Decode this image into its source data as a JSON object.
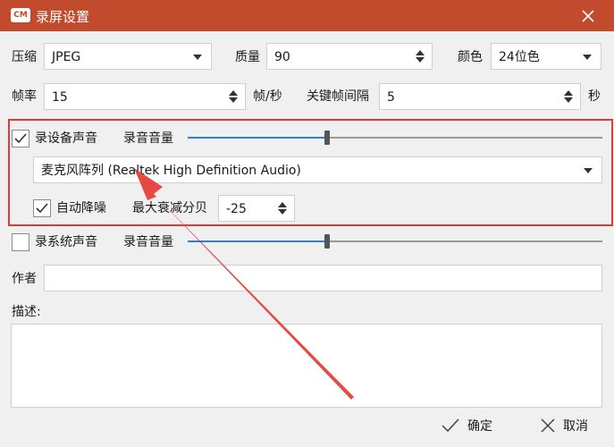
{
  "window": {
    "title": "录屏设置",
    "logo_text": "CM"
  },
  "row1": {
    "compress_label": "压缩",
    "compress_value": "JPEG",
    "quality_label": "质量",
    "quality_value": "90",
    "color_label": "颜色",
    "color_value": "24位色"
  },
  "row2": {
    "fps_label": "帧率",
    "fps_value": "15",
    "fps_unit": "帧/秒",
    "keyframe_label": "关键帧间隔",
    "keyframe_value": "5",
    "keyframe_unit": "秒"
  },
  "device_audio": {
    "checkbox_label": "录设备声音",
    "checked": true,
    "volume_label": "录音音量",
    "volume_level": 0.5,
    "device_value": "麦克风阵列 (Realtek High Definition Audio)",
    "denoise_label": "自动降噪",
    "denoise_checked": true,
    "attenuation_label": "最大衰减分贝",
    "attenuation_value": "-25"
  },
  "system_audio": {
    "checkbox_label": "录系统声音",
    "checked": false,
    "volume_label": "录音音量",
    "volume_level": 0.5
  },
  "author_label": "作者",
  "author_value": "",
  "description_label": "描述:",
  "description_value": "",
  "footer": {
    "ok_label": "确定",
    "cancel_label": "取消"
  },
  "annotation": {
    "color": "#e53935"
  }
}
